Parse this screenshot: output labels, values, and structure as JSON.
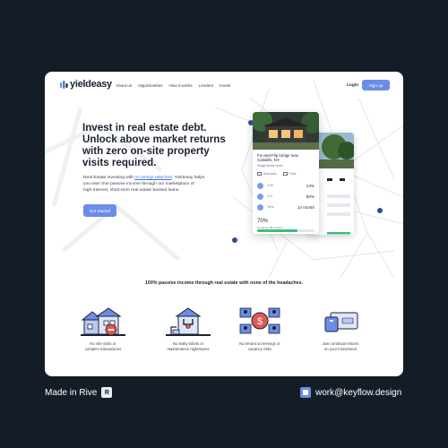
{
  "brand": {
    "name": "yieldeasy"
  },
  "nav": {
    "links": [
      "About us",
      "Opportunities",
      "How it works",
      "Lenders",
      "Invest"
    ],
    "login": "Login",
    "signup": "Sign up"
  },
  "hero": {
    "title_lines": [
      "Invest in real estate debt.",
      "Unlock above market returns",
      "with zero on-site property",
      "visits required."
    ],
    "body_lines": [
      [
        "Real Estate investing with ",
        "no strings attached",
        ". Yieldeasy helps"
      ],
      [
        "you earn true passive income through our marketplace of"
      ],
      [
        "high-interest, short-term real estate backed loans."
      ]
    ],
    "cta": "Get Started"
  },
  "listing": {
    "title_line1": "Fix-and-Flip bridge loan",
    "title_line2": "Catskills, NY.",
    "type": "Single family home",
    "tags": [
      "Bedrooms",
      "Pools"
    ],
    "rows": [
      {
        "label": "LTM",
        "value": "13%"
      },
      {
        "label": "LTV",
        "value": "80%"
      },
      {
        "label": "Term",
        "value": "14 month"
      }
    ],
    "funded_pct": "70%",
    "funded_label": "Funded by 58 investors",
    "funded_fraction": 0.7
  },
  "benefits": {
    "title": "100% passive income through real estate with none of the headaches.",
    "items": [
      {
        "icon": "house-icon",
        "lines": [
          "No site visits or",
          "complex transactions"
        ]
      },
      {
        "icon": "plumbing-icon",
        "lines": [
          "No leaky toilets or",
          "maintenance nightmares"
        ]
      },
      {
        "icon": "tenants-icon",
        "lines": [
          "No tenant screenings or",
          "vacancy risks"
        ]
      },
      {
        "icon": "wallet-icon",
        "lines": [
          "Just continual returns",
          "on your investment"
        ]
      }
    ]
  },
  "footer": {
    "made_in": "Made in Rive",
    "rive_glyph": "R",
    "email": "work@keyflow.design"
  },
  "colors": {
    "accent": "#6b8de9",
    "background": "#141d27",
    "card": "#ffffff",
    "pin": "#2f4c9a",
    "progress": "#3cbf7a"
  }
}
